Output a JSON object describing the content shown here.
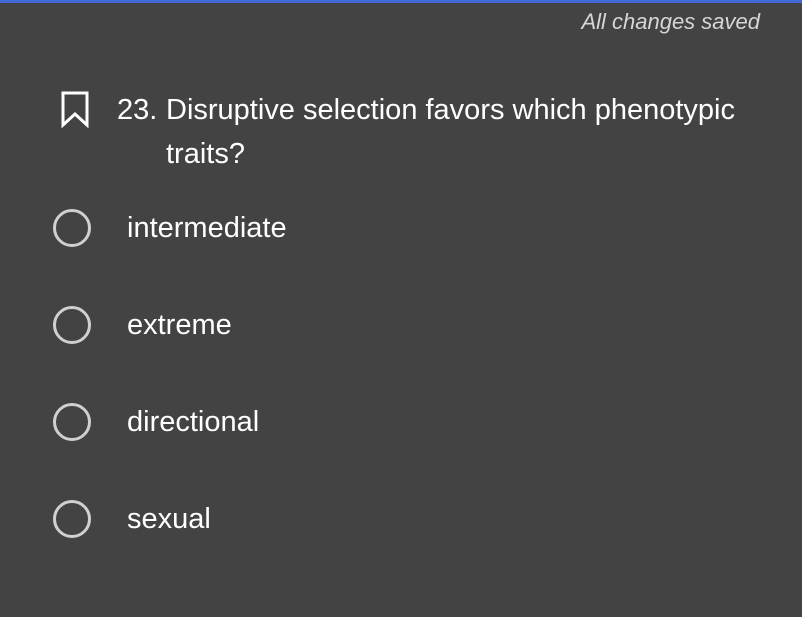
{
  "header": {
    "save_status": "All changes saved",
    "accent_color": "#3f6ad8"
  },
  "question": {
    "number": "23.",
    "text": "Disruptive selection favors which phenotypic traits?",
    "bookmark_icon": "bookmark-outline-icon"
  },
  "options": [
    {
      "label": "intermediate",
      "selected": false
    },
    {
      "label": "extreme",
      "selected": false
    },
    {
      "label": "directional",
      "selected": false
    },
    {
      "label": "sexual",
      "selected": false
    }
  ],
  "colors": {
    "background": "#434343",
    "text": "#ffffff",
    "muted_text": "#d6d6d6",
    "radio_border": "#d0d0d0"
  }
}
